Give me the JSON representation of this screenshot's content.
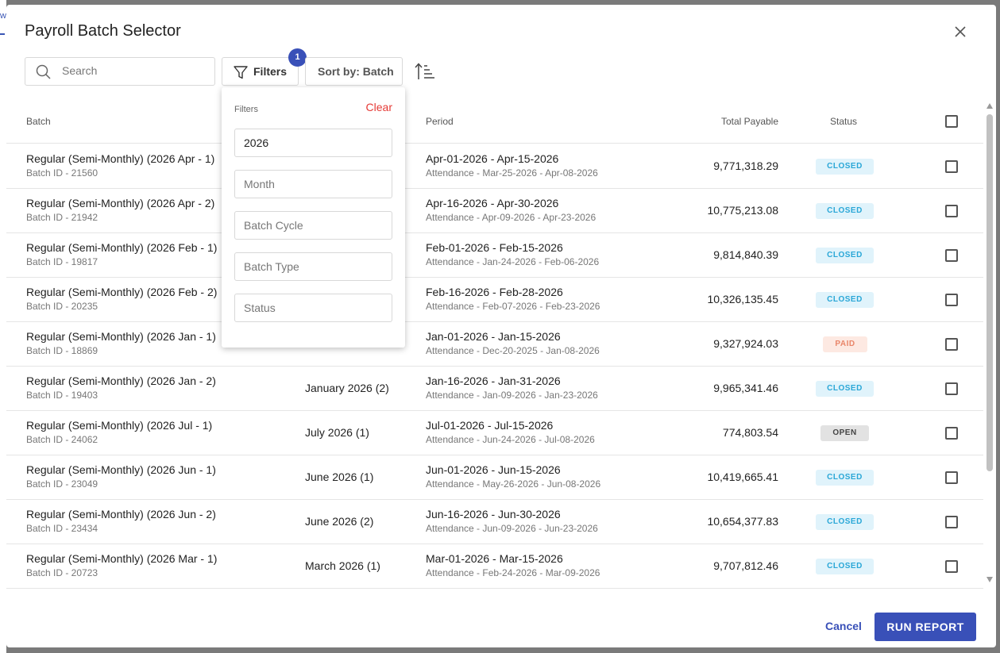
{
  "background": {
    "fragment_text": "w"
  },
  "dialog": {
    "title": "Payroll Batch Selector"
  },
  "toolbar": {
    "search_placeholder": "Search",
    "filters_label": "Filters",
    "filter_badge": "1",
    "sort_label": "Sort by: Batch"
  },
  "columns": {
    "batch": "Batch",
    "period": "Period",
    "total": "Total Payable",
    "status": "Status"
  },
  "rows": [
    {
      "name": "Regular (Semi-Monthly) (2026 Apr - 1)",
      "batch_id": "Batch ID - 21560",
      "month": "",
      "period": "Apr-01-2026 - Apr-15-2026",
      "attendance": "Attendance - Mar-25-2026 - Apr-08-2026",
      "total": "9,771,318.29",
      "status": "CLOSED",
      "status_kind": "closed"
    },
    {
      "name": "Regular (Semi-Monthly) (2026 Apr - 2)",
      "batch_id": "Batch ID - 21942",
      "month": "",
      "period": "Apr-16-2026 - Apr-30-2026",
      "attendance": "Attendance - Apr-09-2026 - Apr-23-2026",
      "total": "10,775,213.08",
      "status": "CLOSED",
      "status_kind": "closed"
    },
    {
      "name": "Regular (Semi-Monthly) (2026 Feb - 1)",
      "batch_id": "Batch ID - 19817",
      "month": "",
      "period": "Feb-01-2026 - Feb-15-2026",
      "attendance": "Attendance - Jan-24-2026 - Feb-06-2026",
      "total": "9,814,840.39",
      "status": "CLOSED",
      "status_kind": "closed"
    },
    {
      "name": "Regular (Semi-Monthly) (2026 Feb - 2)",
      "batch_id": "Batch ID - 20235",
      "month": "",
      "period": "Feb-16-2026 - Feb-28-2026",
      "attendance": "Attendance - Feb-07-2026 - Feb-23-2026",
      "total": "10,326,135.45",
      "status": "CLOSED",
      "status_kind": "closed"
    },
    {
      "name": "Regular (Semi-Monthly) (2026 Jan - 1)",
      "batch_id": "Batch ID - 18869",
      "month": "",
      "period": "Jan-01-2026 - Jan-15-2026",
      "attendance": "Attendance - Dec-20-2025 - Jan-08-2026",
      "total": "9,327,924.03",
      "status": "PAID",
      "status_kind": "paid"
    },
    {
      "name": "Regular (Semi-Monthly) (2026 Jan - 2)",
      "batch_id": "Batch ID - 19403",
      "month": "January 2026 (2)",
      "period": "Jan-16-2026 - Jan-31-2026",
      "attendance": "Attendance - Jan-09-2026 - Jan-23-2026",
      "total": "9,965,341.46",
      "status": "CLOSED",
      "status_kind": "closed"
    },
    {
      "name": "Regular (Semi-Monthly) (2026 Jul - 1)",
      "batch_id": "Batch ID - 24062",
      "month": "July 2026 (1)",
      "period": "Jul-01-2026 - Jul-15-2026",
      "attendance": "Attendance - Jun-24-2026 - Jul-08-2026",
      "total": "774,803.54",
      "status": "OPEN",
      "status_kind": "open"
    },
    {
      "name": "Regular (Semi-Monthly) (2026 Jun - 1)",
      "batch_id": "Batch ID - 23049",
      "month": "June 2026 (1)",
      "period": "Jun-01-2026 - Jun-15-2026",
      "attendance": "Attendance - May-26-2026 - Jun-08-2026",
      "total": "10,419,665.41",
      "status": "CLOSED",
      "status_kind": "closed"
    },
    {
      "name": "Regular (Semi-Monthly) (2026 Jun - 2)",
      "batch_id": "Batch ID - 23434",
      "month": "June 2026 (2)",
      "period": "Jun-16-2026 - Jun-30-2026",
      "attendance": "Attendance - Jun-09-2026 - Jun-23-2026",
      "total": "10,654,377.83",
      "status": "CLOSED",
      "status_kind": "closed"
    },
    {
      "name": "Regular (Semi-Monthly) (2026 Mar - 1)",
      "batch_id": "Batch ID - 20723",
      "month": "March 2026 (1)",
      "period": "Mar-01-2026 - Mar-15-2026",
      "attendance": "Attendance - Feb-24-2026 - Mar-09-2026",
      "total": "9,707,812.46",
      "status": "CLOSED",
      "status_kind": "closed"
    }
  ],
  "filter_panel": {
    "title": "Filters",
    "clear_label": "Clear",
    "year_value": "2026",
    "month_placeholder": "Month",
    "batch_cycle_placeholder": "Batch Cycle",
    "batch_type_placeholder": "Batch Type",
    "status_placeholder": "Status"
  },
  "footer": {
    "cancel_label": "Cancel",
    "run_label": "RUN REPORT"
  },
  "colors": {
    "primary": "#3950b8",
    "clear": "#e53935",
    "closed_bg": "#e0f3fb",
    "closed_fg": "#2aa7d7",
    "paid_bg": "#fde9e2",
    "paid_fg": "#e9866a",
    "open_bg": "#e2e2e2"
  }
}
